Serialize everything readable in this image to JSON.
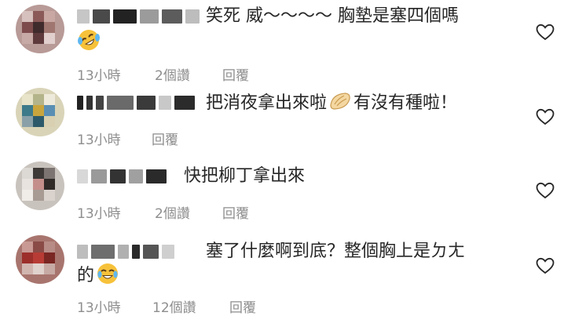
{
  "comments": [
    {
      "text_line1": "笑死 威～～～～ 胸墊是塞四個嗎",
      "emoji_after": "rofl-emoji",
      "time": "13小時",
      "likes": "2個讚",
      "reply": "回覆"
    },
    {
      "text_line1": "把消夜拿出來啦",
      "emoji_mid": "dumpling-emoji",
      "text_line1b": "有沒有種啦！",
      "time": "13小時",
      "reply": "回覆"
    },
    {
      "text_line1": "快把柳丁拿出來",
      "time": "13小時",
      "likes": "2個讚",
      "reply": "回覆"
    },
    {
      "text_line1": "塞了什麼啊到底？整個胸上是ㄉㄤ",
      "text_line2": "的",
      "emoji_after": "joy-emoji",
      "time": "13小時",
      "likes": "12個讚",
      "reply": "回覆"
    }
  ],
  "colors": {
    "text": "#262626",
    "meta": "#8e8e8e",
    "heart": "#262626"
  },
  "icons": {
    "like": "heart-outline-icon"
  }
}
